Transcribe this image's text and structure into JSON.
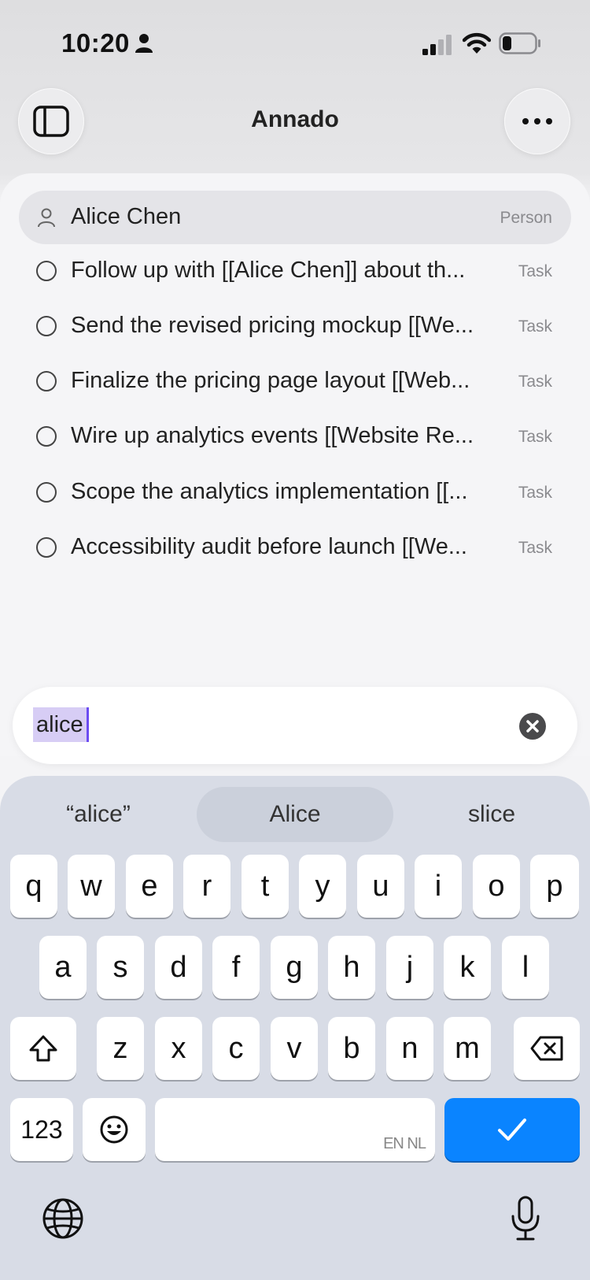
{
  "status_bar": {
    "time": "10:20"
  },
  "header": {
    "title": "Annado"
  },
  "results": [
    {
      "title": "Alice Chen",
      "type": "Person",
      "icon": "person-icon",
      "highlighted": true
    },
    {
      "title": "Follow up with [[Alice Chen]] about th...",
      "type": "Task",
      "icon": "circle-icon"
    },
    {
      "title": "Send the revised pricing mockup [[We...",
      "type": "Task",
      "icon": "circle-icon"
    },
    {
      "title": "Finalize the pricing page layout [[Web...",
      "type": "Task",
      "icon": "circle-icon"
    },
    {
      "title": "Wire up analytics events [[Website Re...",
      "type": "Task",
      "icon": "circle-icon"
    },
    {
      "title": "Scope the analytics implementation [[...",
      "type": "Task",
      "icon": "circle-icon"
    },
    {
      "title": "Accessibility audit before launch [[We...",
      "type": "Task",
      "icon": "circle-icon"
    }
  ],
  "search": {
    "value": "alice"
  },
  "keyboard": {
    "suggestions": [
      "“alice”",
      "Alice",
      "slice"
    ],
    "row1": [
      "q",
      "w",
      "e",
      "r",
      "t",
      "y",
      "u",
      "i",
      "o",
      "p"
    ],
    "row2": [
      "a",
      "s",
      "d",
      "f",
      "g",
      "h",
      "j",
      "k",
      "l"
    ],
    "row3": [
      "z",
      "x",
      "c",
      "v",
      "b",
      "n",
      "m"
    ],
    "numbers_label": "123",
    "space_languages": "EN NL",
    "accent_color": "#0a84ff"
  }
}
